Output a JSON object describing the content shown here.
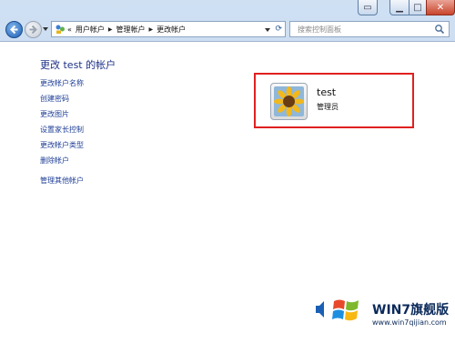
{
  "address": {
    "parts": [
      "用户帐户",
      "管理帐户",
      "更改帐户"
    ],
    "history_prefix": "«"
  },
  "search": {
    "placeholder": "搜索控制面板"
  },
  "page": {
    "title": "更改 test 的帐户"
  },
  "tasks": [
    "更改帐户名称",
    "创建密码",
    "更改图片",
    "设置家长控制",
    "更改帐户类型",
    "删除帐户",
    "管理其他帐户"
  ],
  "user": {
    "name": "test",
    "role": "管理员"
  },
  "watermark": {
    "title": "WIN7旗舰版",
    "url": "www.win7qijian.com"
  },
  "colors": {
    "highlight": "#e02020",
    "link": "#1f3f97",
    "title": "#1e3287"
  }
}
